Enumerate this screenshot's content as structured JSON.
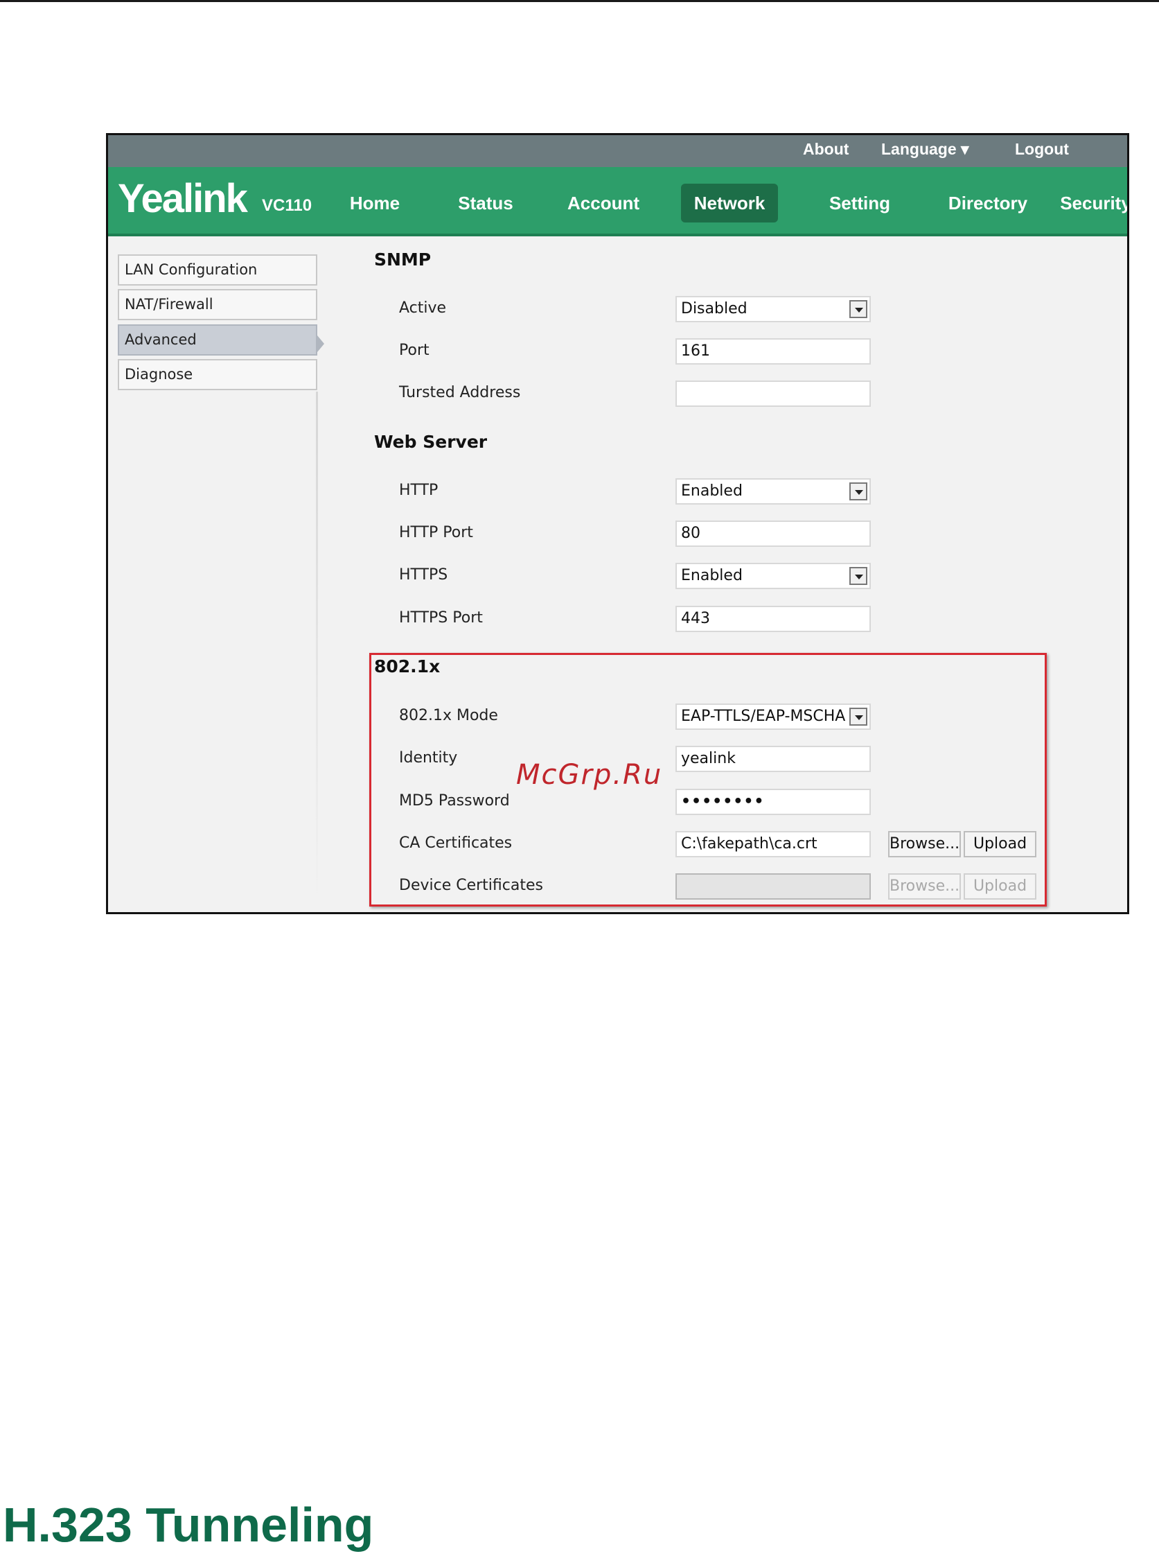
{
  "top_links": {
    "about": "About",
    "language": "Language ▾",
    "logout": "Logout"
  },
  "brand": {
    "logo": "Yealink",
    "model": "VC110",
    "color": "#2d9e6a"
  },
  "nav": {
    "home": "Home",
    "status": "Status",
    "account": "Account",
    "network": "Network",
    "setting": "Setting",
    "directory": "Directory",
    "security": "Security",
    "active": "Network"
  },
  "sidebar": {
    "items": [
      "LAN Configuration",
      "NAT/Firewall",
      "Advanced",
      "Diagnose"
    ],
    "active": "Advanced"
  },
  "snmp": {
    "title": "SNMP",
    "active_label": "Active",
    "active_value": "Disabled",
    "port_label": "Port",
    "port_value": "161",
    "trusted_label": "Tursted Address",
    "trusted_value": ""
  },
  "web_server": {
    "title": "Web Server",
    "http_label": "HTTP",
    "http_value": "Enabled",
    "http_port_label": "HTTP Port",
    "http_port_value": "80",
    "https_label": "HTTPS",
    "https_value": "Enabled",
    "https_port_label": "HTTPS Port",
    "https_port_value": "443"
  },
  "dot1x": {
    "title": "802.1x",
    "mode_label": "802.1x Mode",
    "mode_value": "EAP-TTLS/EAP-MSCHA",
    "identity_label": "Identity",
    "identity_value": "yealink",
    "password_label": "MD5 Password",
    "password_value": "••••••••",
    "ca_label": "CA Certificates",
    "ca_value": "C:\\fakepath\\ca.crt",
    "device_label": "Device Certificates",
    "device_value": "",
    "browse_label": "Browse...",
    "upload_label": "Upload"
  },
  "watermark": "McGrp.Ru",
  "footer": {
    "title": "H.323 Tunneling"
  },
  "colors": {
    "highlight": "#d72a32",
    "footer_title": "#0f6a4a",
    "top_bar": "#6c7b7f"
  }
}
